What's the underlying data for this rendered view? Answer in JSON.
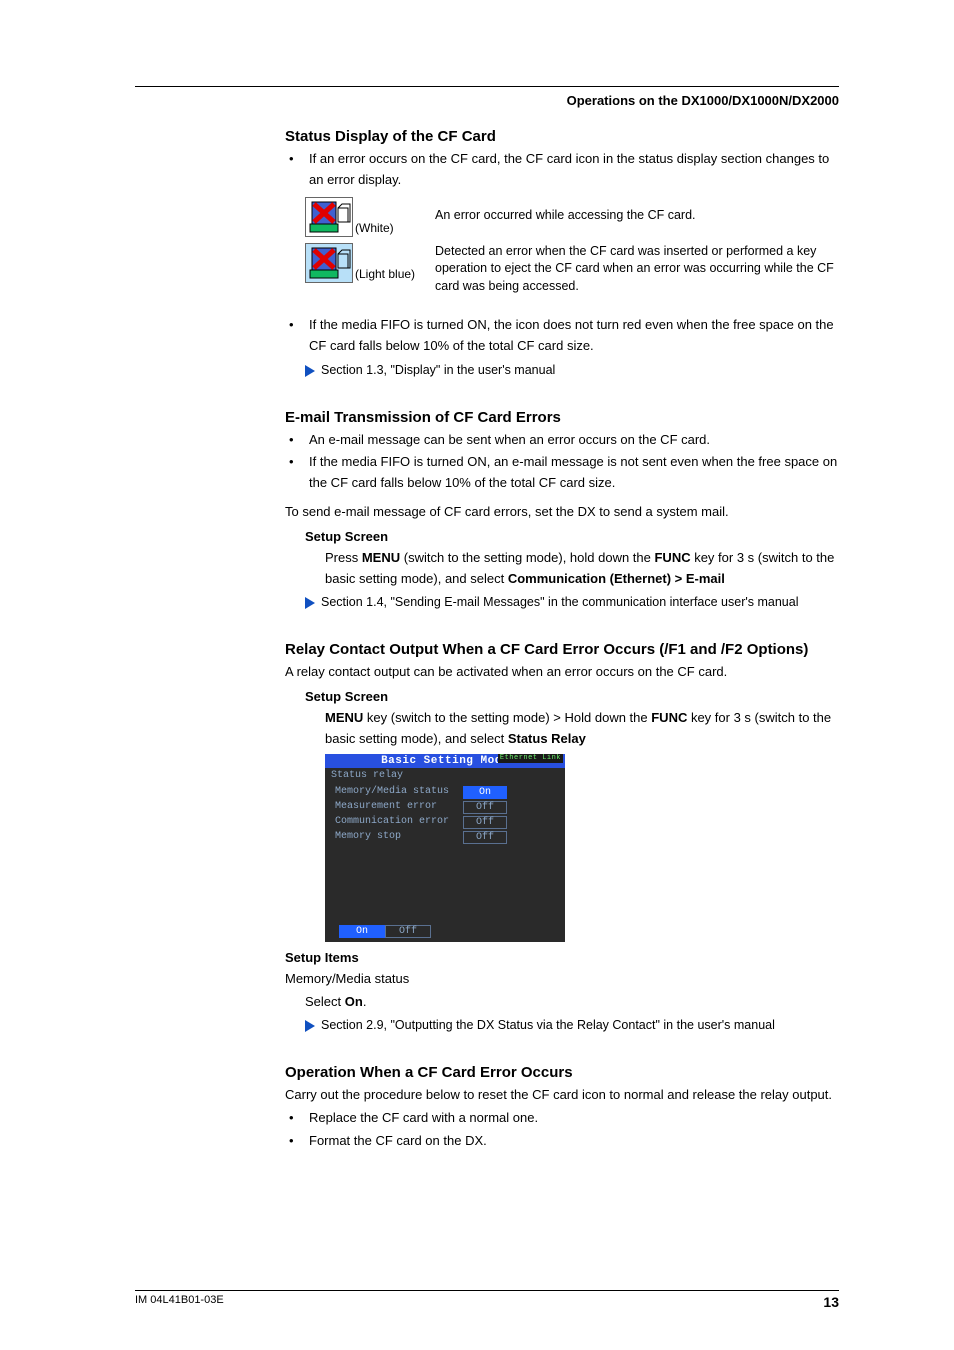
{
  "header": {
    "section_title": "Operations on the DX1000/DX1000N/DX2000"
  },
  "s1": {
    "title": "Status Display of the CF Card",
    "b1": "If an error occurs on the CF card, the CF card icon in the status display section changes to an error display.",
    "icon1_label": "(White)",
    "icon1_desc": "An error occurred while accessing the CF card.",
    "icon2_label": "(Light blue)",
    "icon2_desc": "Detected an error when the CF card was inserted or performed a key operation to eject the CF card when an error was occurring while the CF card was being accessed.",
    "b2": "If the media FIFO is turned ON, the icon does not turn red even when the free space on the CF card falls below 10% of the total CF card size.",
    "ref": "Section 1.3, \"Display\" in the user's manual"
  },
  "s2": {
    "title": "E-mail Transmission of CF Card Errors",
    "b1": "An e-mail message can be sent when an error occurs on the CF card.",
    "b2": "If the media FIFO is turned ON, an e-mail message is not sent even when the free space on the CF card falls below 10% of the total CF card size.",
    "p1": "To send e-mail message of CF card errors, set the DX to send a system mail.",
    "h3": "Setup Screen",
    "p2a": "Press ",
    "p2b": "MENU",
    "p2c": " (switch to the setting mode), hold down the ",
    "p2d": "FUNC",
    "p2e": " key for 3 s (switch to the basic setting mode), and select ",
    "p2f": "Communication (Ethernet) > E-mail",
    "ref": "Section 1.4, \"Sending E-mail Messages\" in the communication interface user's manual"
  },
  "s3": {
    "title": "Relay Contact Output When a CF Card Error Occurs (/F1 and /F2 Options)",
    "p1": "A relay contact output can be activated when an error occurs on the CF card.",
    "h3": "Setup Screen",
    "p2a": "MENU",
    "p2b": " key (switch to the setting mode) > Hold down the ",
    "p2c": "FUNC",
    "p2d": " key for 3 s (switch to the basic setting mode), and select ",
    "p2e": "Status Relay",
    "screen": {
      "title": "Basic Setting Mode",
      "eth": "Ethernet\nLink",
      "subtitle": "Status relay",
      "rows": [
        {
          "label": "Memory/Media status",
          "value": "On",
          "selected": true
        },
        {
          "label": "Measurement error",
          "value": "Off",
          "selected": false
        },
        {
          "label": "Communication error",
          "value": "Off",
          "selected": false
        },
        {
          "label": "Memory stop",
          "value": "Off",
          "selected": false
        }
      ],
      "btn_on": "On",
      "btn_off": "Off"
    },
    "h3b": "Setup Items",
    "p3": "Memory/Media status",
    "p4a": "Select ",
    "p4b": "On",
    "p4c": ".",
    "ref": "Section 2.9, \"Outputting the DX Status via the Relay Contact\" in the user's manual"
  },
  "s4": {
    "title": "Operation When a CF Card Error Occurs",
    "p1": "Carry out the procedure below to reset the CF card icon to normal and release the relay output.",
    "b1": "Replace the CF card with a normal one.",
    "b2": "Format the CF card on the DX."
  },
  "footer": {
    "doc_id": "IM 04L41B01-03E",
    "page": "13"
  }
}
